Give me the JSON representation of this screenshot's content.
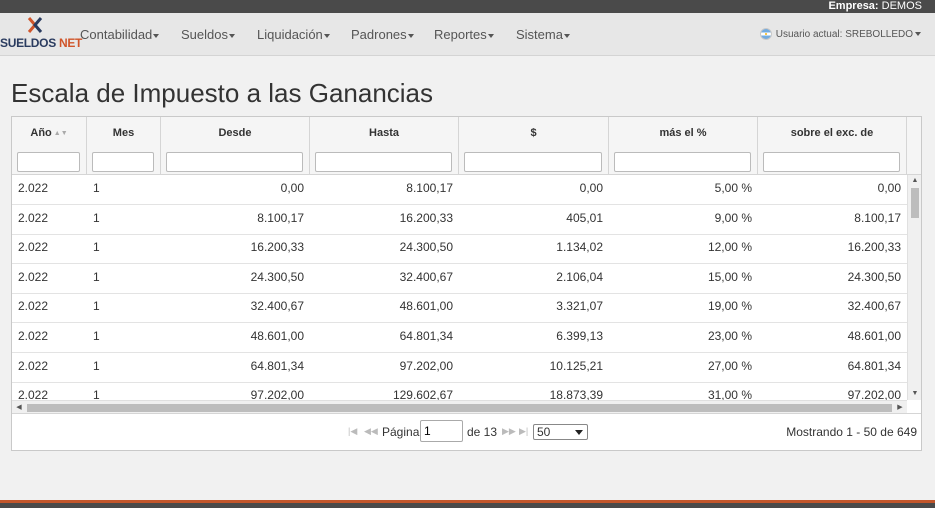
{
  "topbar": {
    "empresa_label": "Empresa:",
    "empresa_value": "DEMOS"
  },
  "logo": {
    "text_a": "SUELDOS",
    "text_b": "NET"
  },
  "nav": {
    "items": [
      {
        "label": "Contabilidad"
      },
      {
        "label": "Sueldos"
      },
      {
        "label": "Liquidación"
      },
      {
        "label": "Padrones"
      },
      {
        "label": "Reportes"
      },
      {
        "label": "Sistema"
      }
    ],
    "user_label": "Usuario actual: SREBOLLEDO"
  },
  "page": {
    "title": "Escala de Impuesto a las Ganancias"
  },
  "table": {
    "columns": [
      {
        "label": "Año",
        "sortable": true
      },
      {
        "label": "Mes"
      },
      {
        "label": "Desde"
      },
      {
        "label": "Hasta"
      },
      {
        "label": "$"
      },
      {
        "label": "más el %"
      },
      {
        "label": "sobre el exc. de"
      }
    ],
    "rows": [
      [
        "2.022",
        "1",
        "0,00",
        "8.100,17",
        "0,00",
        "5,00 %",
        "0,00"
      ],
      [
        "2.022",
        "1",
        "8.100,17",
        "16.200,33",
        "405,01",
        "9,00 %",
        "8.100,17"
      ],
      [
        "2.022",
        "1",
        "16.200,33",
        "24.300,50",
        "1.134,02",
        "12,00 %",
        "16.200,33"
      ],
      [
        "2.022",
        "1",
        "24.300,50",
        "32.400,67",
        "2.106,04",
        "15,00 %",
        "24.300,50"
      ],
      [
        "2.022",
        "1",
        "32.400,67",
        "48.601,00",
        "3.321,07",
        "19,00 %",
        "32.400,67"
      ],
      [
        "2.022",
        "1",
        "48.601,00",
        "64.801,34",
        "6.399,13",
        "23,00 %",
        "48.601,00"
      ],
      [
        "2.022",
        "1",
        "64.801,34",
        "97.202,00",
        "10.125,21",
        "27,00 %",
        "64.801,34"
      ],
      [
        "2.022",
        "1",
        "97.202,00",
        "129.602,67",
        "18.873,39",
        "31,00 %",
        "97.202,00"
      ]
    ]
  },
  "pager": {
    "page_label": "Página",
    "current_page": "1",
    "total_label": "de 13",
    "page_size": "50",
    "showing": "Mostrando 1 - 50 de 649"
  },
  "colors": {
    "accent": "#c2562b",
    "topbar": "#4a4a4a",
    "navbar": "#e7e7e7"
  }
}
